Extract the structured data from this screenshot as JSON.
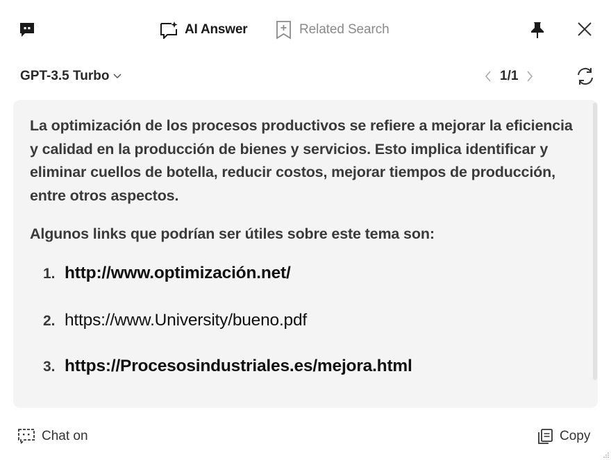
{
  "header": {
    "tabs": [
      {
        "label": "AI Answer",
        "icon": "ai-answer-icon",
        "active": true
      },
      {
        "label": "Related Search",
        "icon": "related-search-icon",
        "active": false
      }
    ]
  },
  "toolbar": {
    "model": "GPT-3.5 Turbo",
    "pager": "1/1"
  },
  "answer": {
    "paragraph": "La optimización de los procesos productivos se refiere a mejorar la eficiencia y calidad en la producción de bienes y servicios. Esto implica identificar y eliminar cuellos de botella, reducir costos, mejorar tiempos de producción, entre otros aspectos.",
    "intro": "Algunos links que podrían ser útiles sobre este tema son:",
    "links": [
      {
        "number": "1.",
        "url": "http://www.optimización.net/",
        "bold": true
      },
      {
        "number": "2.",
        "url": "https://www.University/bueno.pdf",
        "bold": false
      },
      {
        "number": "3.",
        "url": "https://Procesosindustriales.es/mejora.html",
        "bold": true
      }
    ]
  },
  "footer": {
    "chat_label": "Chat on",
    "copy_label": "Copy"
  },
  "colors": {
    "card_background": "#f4f4f4",
    "inactive_tab": "#8a8a8a"
  }
}
